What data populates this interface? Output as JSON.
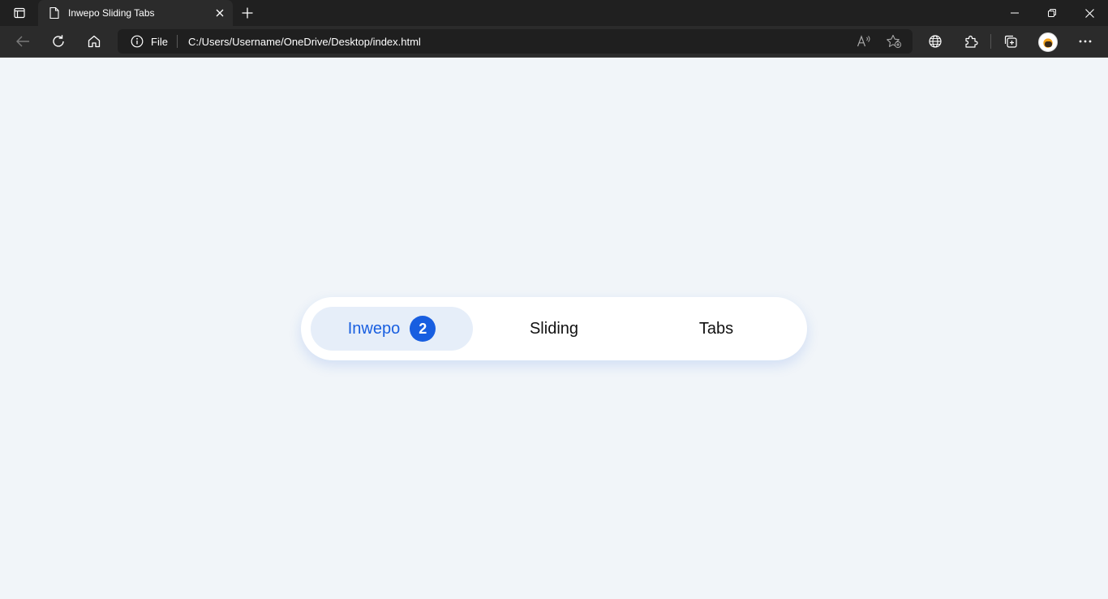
{
  "browser": {
    "tab_title": "Inwepo Sliding Tabs",
    "address": {
      "scheme_label": "File",
      "url": "C:/Users/Username/OneDrive/Desktop/index.html"
    }
  },
  "page": {
    "tabs": [
      {
        "label": "Inwepo",
        "badge": "2",
        "active": true
      },
      {
        "label": "Sliding",
        "active": false
      },
      {
        "label": "Tabs",
        "active": false
      }
    ]
  },
  "colors": {
    "accent": "#185ee0",
    "glider": "#e6eef9",
    "page_bg": "#f1f5f9",
    "chrome_dark": "#202020",
    "toolbar": "#2b2b2b"
  },
  "icons": {
    "tab_actions": "tab-actions-icon",
    "favicon": "page-icon",
    "close": "close-icon",
    "new_tab": "plus-icon",
    "back": "back-arrow-icon",
    "refresh": "refresh-icon",
    "home": "home-icon",
    "info": "info-icon",
    "read_aloud": "read-aloud-icon",
    "favorites": "add-favorite-icon",
    "browser_essentials": "globe-icon",
    "extensions": "puzzle-icon",
    "collections": "collections-icon",
    "more": "more-icon"
  }
}
